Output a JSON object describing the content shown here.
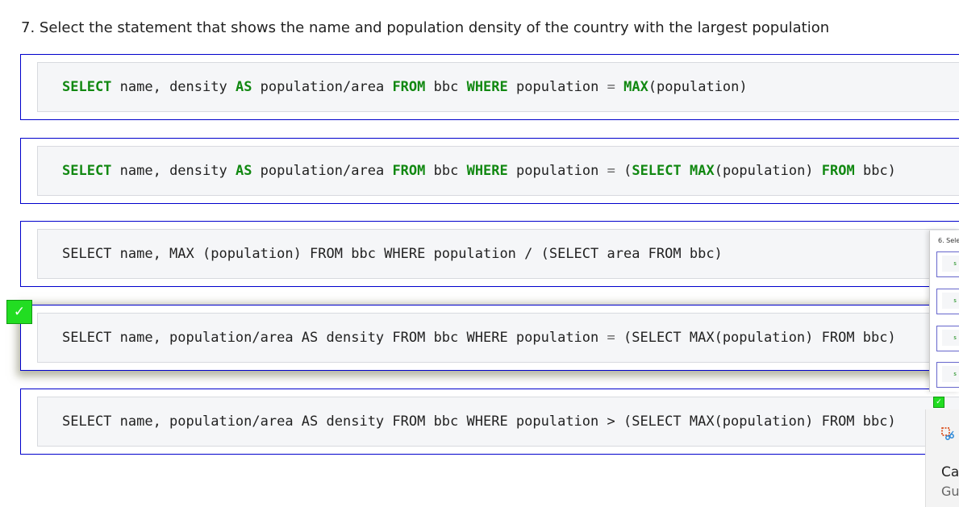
{
  "question": {
    "text": "7. Select the statement that shows the name and population density of the country with the largest population"
  },
  "options": [
    {
      "tokens": [
        {
          "t": "SELECT",
          "kw": true
        },
        {
          "t": " name, density "
        },
        {
          "t": "AS",
          "kw": true
        },
        {
          "t": " population/area "
        },
        {
          "t": "FROM",
          "kw": true
        },
        {
          "t": " bbc "
        },
        {
          "t": "WHERE",
          "kw": true
        },
        {
          "t": " population "
        },
        {
          "t": "=",
          "op": true
        },
        {
          "t": " "
        },
        {
          "t": "MAX",
          "kw": true
        },
        {
          "t": "(population)"
        }
      ],
      "selected": false
    },
    {
      "tokens": [
        {
          "t": "SELECT",
          "kw": true
        },
        {
          "t": " name, density "
        },
        {
          "t": "AS",
          "kw": true
        },
        {
          "t": " population/area "
        },
        {
          "t": "FROM",
          "kw": true
        },
        {
          "t": " bbc "
        },
        {
          "t": "WHERE",
          "kw": true
        },
        {
          "t": " population "
        },
        {
          "t": "=",
          "op": true
        },
        {
          "t": " ("
        },
        {
          "t": "SELECT",
          "kw": true
        },
        {
          "t": " "
        },
        {
          "t": "MAX",
          "kw": true
        },
        {
          "t": "(population) "
        },
        {
          "t": "FROM",
          "kw": true
        },
        {
          "t": " bbc)"
        }
      ],
      "selected": false
    },
    {
      "tokens": [
        {
          "t": "SELECT name, MAX (population) FROM bbc WHERE population / (SELECT area FROM bbc)"
        }
      ],
      "selected": false
    },
    {
      "tokens": [
        {
          "t": "SELECT name, population/area AS density FROM bbc WHERE population "
        },
        {
          "t": "=",
          "op": true
        },
        {
          "t": " (SELECT MAX(population) FROM bbc)"
        }
      ],
      "selected": true
    },
    {
      "tokens": [
        {
          "t": "SELECT name, population/area AS density FROM bbc WHERE population > (SELECT MAX(population) FROM bbc)"
        }
      ],
      "selected": false
    }
  ],
  "check_mark": "✓",
  "thumbnail": {
    "title": "6. Selec",
    "mini_label": "s",
    "check_mark": "✓"
  },
  "side_panel": {
    "line1": "Ca",
    "line2": "Gu",
    "icon": "snip-icon"
  },
  "colors": {
    "keyword": "#118811",
    "border": "#0000cc",
    "check": "#22dd22"
  }
}
